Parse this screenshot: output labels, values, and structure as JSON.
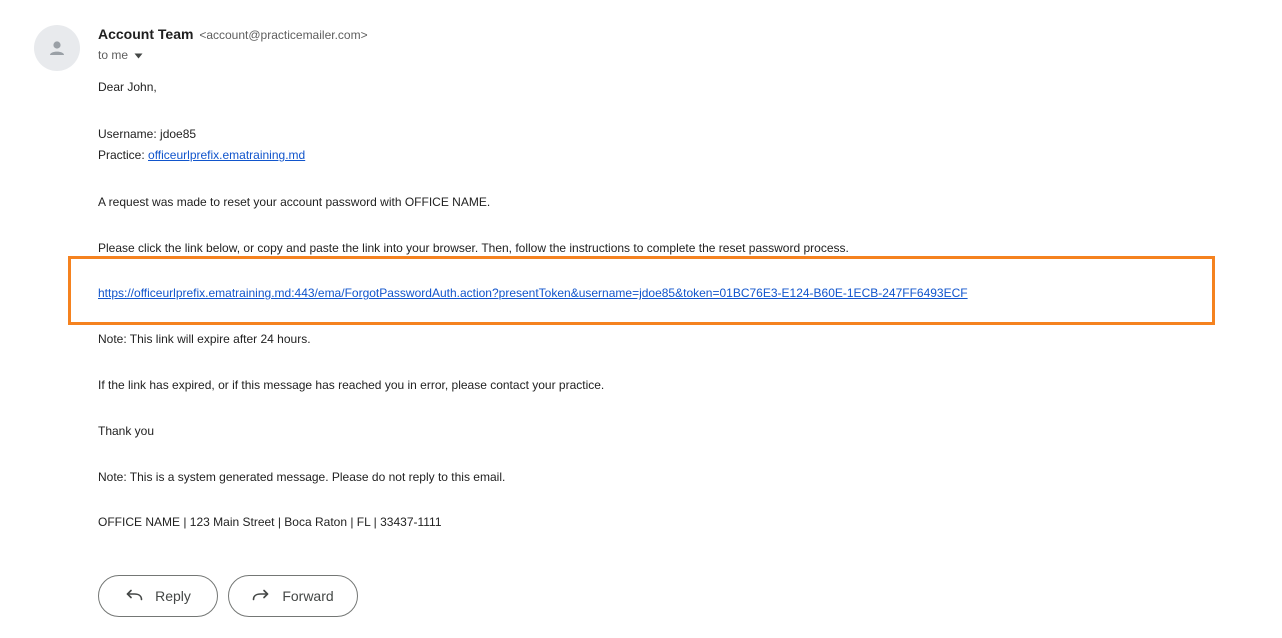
{
  "message": {
    "sender_name": "Account Team",
    "sender_email": "<account@practicemailer.com>",
    "recipient_label": "to me",
    "greeting": "Dear John,",
    "username_line": "Username: jdoe85",
    "practice_label": "Practice: ",
    "practice_link": "officeurlprefix.ematraining.md",
    "request_text": "A request was made to reset your account password with OFFICE NAME.",
    "instructions": "Please click the link below, or copy and paste the link into your browser. Then, follow the instructions to complete the reset password process.",
    "reset_link": "https://officeurlprefix.ematraining.md:443/ema/ForgotPasswordAuth.action?presentToken&username=jdoe85&token=01BC76E3-E124-B60E-1ECB-247FF6493ECF",
    "expire_note": "Note: This link will expire after 24 hours.",
    "error_note": "If the link has expired, or if this message has reached you in error, please contact your practice.",
    "thanks": "Thank you",
    "system_note": "Note: This is a system generated message. Please do not reply to this email.",
    "footer": "OFFICE NAME | 123 Main Street | Boca Raton | FL | 33437-1111"
  },
  "actions": {
    "reply_label": "Reply",
    "forward_label": "Forward"
  },
  "icons": {
    "avatar": "person-icon",
    "recipient_toggle": "caret-down-icon",
    "reply": "reply-arrow-icon",
    "forward": "forward-arrow-icon"
  },
  "colors": {
    "highlight": "#f5821f",
    "link": "#1155cc"
  }
}
